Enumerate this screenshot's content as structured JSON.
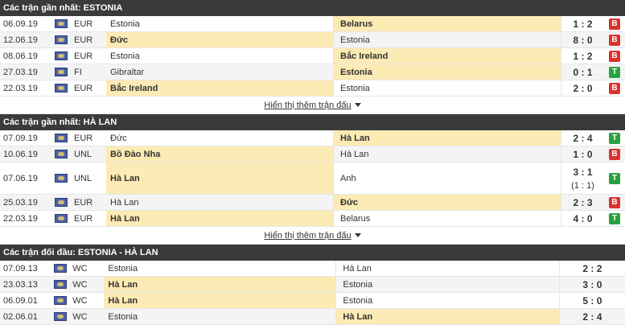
{
  "sections": [
    {
      "title": "Các trận gần nhất: ESTONIA",
      "more": "Hiển thị thêm trận đấu",
      "rows": [
        {
          "date": "06.09.19",
          "comp": "EUR",
          "home": "Estonia",
          "away": "Belarus",
          "score": "1 : 2",
          "result": "B",
          "winner": "away"
        },
        {
          "date": "12.06.19",
          "comp": "EUR",
          "home": "Đức",
          "away": "Estonia",
          "score": "8 : 0",
          "result": "B",
          "winner": "home"
        },
        {
          "date": "08.06.19",
          "comp": "EUR",
          "home": "Estonia",
          "away": "Bắc Ireland",
          "score": "1 : 2",
          "result": "B",
          "winner": "away"
        },
        {
          "date": "27.03.19",
          "comp": "FI",
          "home": "Gibraltar",
          "away": "Estonia",
          "score": "0 : 1",
          "result": "T",
          "winner": "away"
        },
        {
          "date": "22.03.19",
          "comp": "EUR",
          "home": "Bắc Ireland",
          "away": "Estonia",
          "score": "2 : 0",
          "result": "B",
          "winner": "home"
        }
      ]
    },
    {
      "title": "Các trận gần nhất: HÀ LAN",
      "more": "Hiển thị thêm trận đấu",
      "rows": [
        {
          "date": "07.09.19",
          "comp": "EUR",
          "home": "Đức",
          "away": "Hà Lan",
          "score": "2 : 4",
          "result": "T",
          "winner": "away"
        },
        {
          "date": "10.06.19",
          "comp": "UNL",
          "home": "Bồ Đào Nha",
          "away": "Hà Lan",
          "score": "1 : 0",
          "result": "B",
          "winner": "home"
        },
        {
          "date": "07.06.19",
          "comp": "UNL",
          "home": "Hà Lan",
          "away": "Anh",
          "score": "3 : 1",
          "sub_score": "(1 : 1)",
          "result": "T",
          "winner": "home",
          "tall": true
        },
        {
          "date": "25.03.19",
          "comp": "EUR",
          "home": "Hà Lan",
          "away": "Đức",
          "score": "2 : 3",
          "result": "B",
          "winner": "away"
        },
        {
          "date": "22.03.19",
          "comp": "EUR",
          "home": "Hà Lan",
          "away": "Belarus",
          "score": "4 : 0",
          "result": "T",
          "winner": "home"
        }
      ]
    },
    {
      "title": "Các trận đối đầu: ESTONIA - HÀ LAN",
      "rows": [
        {
          "date": "07.09.13",
          "comp": "WC",
          "home": "Estonia",
          "away": "Hà Lan",
          "score": "2 : 2",
          "winner": "none"
        },
        {
          "date": "23.03.13",
          "comp": "WC",
          "home": "Hà Lan",
          "away": "Estonia",
          "score": "3 : 0",
          "winner": "home"
        },
        {
          "date": "06.09.01",
          "comp": "WC",
          "home": "Hà Lan",
          "away": "Estonia",
          "score": "5 : 0",
          "winner": "home"
        },
        {
          "date": "02.06.01",
          "comp": "WC",
          "home": "Estonia",
          "away": "Hà Lan",
          "score": "2 : 4",
          "winner": "away"
        }
      ]
    }
  ]
}
